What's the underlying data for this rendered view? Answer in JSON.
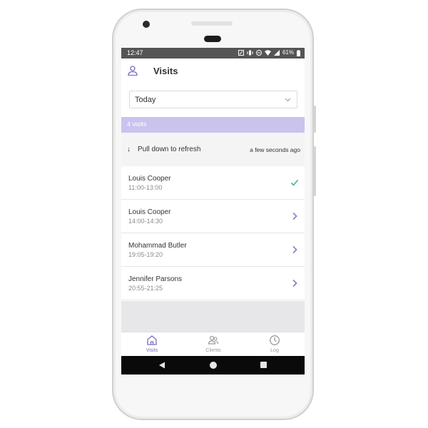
{
  "status_bar": {
    "time": "12:47",
    "battery": "61%"
  },
  "app_bar": {
    "title": "Visits",
    "profile_icon": "person-icon"
  },
  "date_filter": {
    "selected": "Today",
    "icon": "chevron-down-icon"
  },
  "visit_count": "4 visits",
  "refresh": {
    "label": "Pull down to refresh",
    "updated": "a few seconds ago",
    "icon": "arrow-down-icon"
  },
  "visits": [
    {
      "name": "Louis Cooper",
      "time": "11:00-13:00",
      "status_icon": "checkmark-icon"
    },
    {
      "name": "Louis Cooper",
      "time": "14:00-14:30",
      "status_icon": "chevron-right-icon"
    },
    {
      "name": "Mohammad Butler",
      "time": "19:05-19:20",
      "status_icon": "chevron-right-icon"
    },
    {
      "name": "Jennifer Parsons",
      "time": "20:55-21:25",
      "status_icon": "chevron-right-icon"
    }
  ],
  "bottom_nav": [
    {
      "label": "Visits",
      "icon": "home-icon",
      "active": true
    },
    {
      "label": "Clients",
      "icon": "people-icon",
      "active": false
    },
    {
      "label": "Log",
      "icon": "clock-icon",
      "active": false
    }
  ],
  "colors": {
    "accent": "#7a6fc0",
    "banner": "#c9c3ee",
    "check": "#3fb3a5",
    "chevron": "#8a82c8"
  }
}
